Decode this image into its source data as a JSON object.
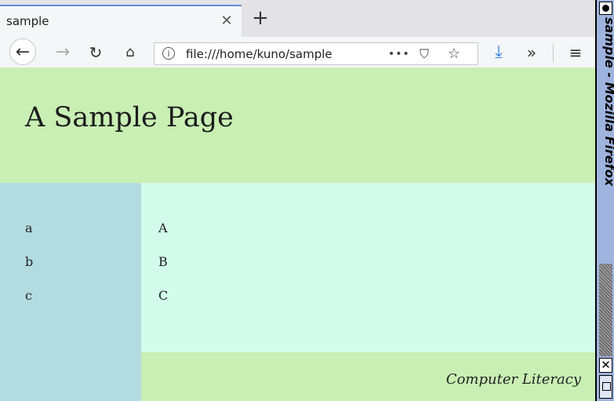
{
  "tab": {
    "title": "sample",
    "close_icon": "close-icon",
    "new_tab_icon": "plus-icon"
  },
  "navbar": {
    "url": "file:///home/kuno/sample",
    "icons": [
      "back-arrow-icon",
      "forward-arrow-icon",
      "reload-icon",
      "home-icon",
      "info-icon",
      "more-icon",
      "pocket-icon",
      "star-icon",
      "download-icon",
      "overflow-icon",
      "menu-icon"
    ]
  },
  "page": {
    "title": "A Sample Page",
    "sidebar_items": [
      "a",
      "b",
      "c"
    ],
    "main_items": [
      "A",
      "B",
      "C"
    ],
    "footer": "Computer Literacy"
  },
  "window_manager": {
    "title": "sample - Mozilla Firefox"
  },
  "colors": {
    "header": "#c9efb4",
    "sidebar": "#b3dce0",
    "main": "#d2fbeb",
    "footer": "#c9efb4",
    "tab_accent": "#5b8fd6",
    "download": "#2a7de1",
    "wm_bar": "#9fb3df"
  }
}
